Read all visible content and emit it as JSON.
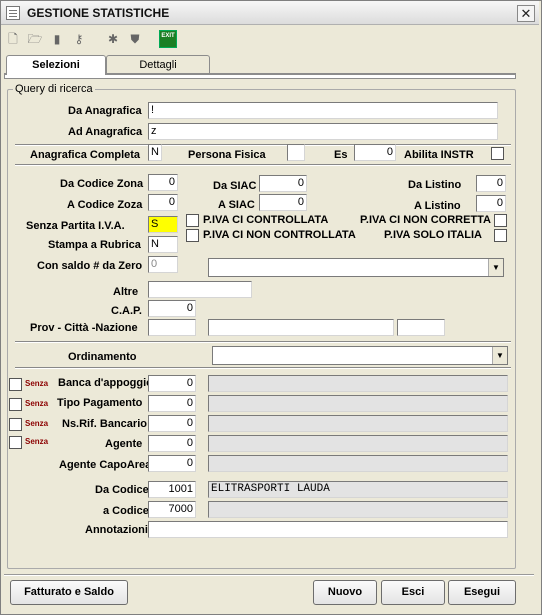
{
  "window": {
    "title": "GESTIONE STATISTICHE",
    "close_glyph": "✕"
  },
  "toolbar": {
    "items": [
      {
        "name": "new-document-icon",
        "glyph": "🗋"
      },
      {
        "name": "open-folder-icon",
        "glyph": "🗁"
      },
      {
        "name": "document-icon",
        "glyph": "▮"
      },
      {
        "name": "key-icon",
        "glyph": "⚷"
      },
      {
        "name": "wand-icon",
        "glyph": "✱"
      },
      {
        "name": "shield-icon",
        "glyph": "⛊"
      },
      {
        "name": "exit-icon",
        "label": "EXIT"
      }
    ]
  },
  "tabs": [
    {
      "label": "Selezioni",
      "active": true
    },
    {
      "label": "Dettagli",
      "active": false
    }
  ],
  "group": {
    "legend": "Query di ricerca"
  },
  "anagrafica": {
    "da_label": "Da Anagrafica",
    "da_value": "!",
    "ad_label": "Ad Anagrafica",
    "ad_value": "z",
    "completa_label": "Anagrafica Completa",
    "completa_value": "N",
    "persona_fisica_label": "Persona Fisica",
    "persona_fisica_value": "",
    "es_label": "Es",
    "es_value": "0",
    "abilita_label": "Abilita INSTR"
  },
  "codici": {
    "da_zona_label": "Da Codice Zona",
    "da_zona_value": "0",
    "a_zona_label": "A Codice Zoza",
    "a_zona_value": "0",
    "da_siac_label": "Da SIAC",
    "da_siac_value": "0",
    "a_siac_label": "A SIAC",
    "a_siac_value": "0",
    "da_listino_label": "Da Listino",
    "da_listino_value": "0",
    "a_listino_label": "A Listino",
    "a_listino_value": "0",
    "senza_piva_label": "Senza Partita I.V.A.",
    "senza_piva_value": "S",
    "stampa_rubrica_label": "Stampa a Rubrica",
    "stampa_rubrica_value": "N",
    "con_saldo_label": "Con saldo # da Zero",
    "con_saldo_value": "0",
    "piva_controllata": "P.IVA CI CONTROLLATA",
    "piva_non_controllata": "P.IVA CI NON CONTROLLATA",
    "piva_non_corretta": "P.IVA CI NON CORRETTA",
    "piva_solo_italia": "P.IVA SOLO ITALIA"
  },
  "indirizzo": {
    "altre_label": "Altre",
    "altre_value": "",
    "cap_label": "C.A.P.",
    "cap_value": "0",
    "prov_label": "Prov - Città -Nazione"
  },
  "ordinamento": {
    "label": "Ordinamento",
    "value": ""
  },
  "filtri": {
    "senza_label": "Senza",
    "banca_label": "Banca d'appoggio",
    "banca_value": "0",
    "pagamento_label": "Tipo Pagamento",
    "pagamento_value": "0",
    "nsrif_label": "Ns.Rif. Bancario",
    "nsrif_value": "0",
    "agente_label": "Agente",
    "agente_value": "0",
    "capoarea_label": "Agente CapoArea",
    "capoarea_value": "0",
    "da_codice_label": "Da Codice",
    "da_codice_value": "1001",
    "da_codice_desc": "ELITRASPORTI LAUDA",
    "a_codice_label": "a Codice",
    "a_codice_value": "7000",
    "a_codice_desc": "",
    "annotazioni_label": "Annotazioni",
    "annotazioni_value": ""
  },
  "buttons": {
    "fatturato": "Fatturato e Saldo",
    "nuovo": "Nuovo",
    "esci": "Esci",
    "esegui": "Esegui"
  }
}
